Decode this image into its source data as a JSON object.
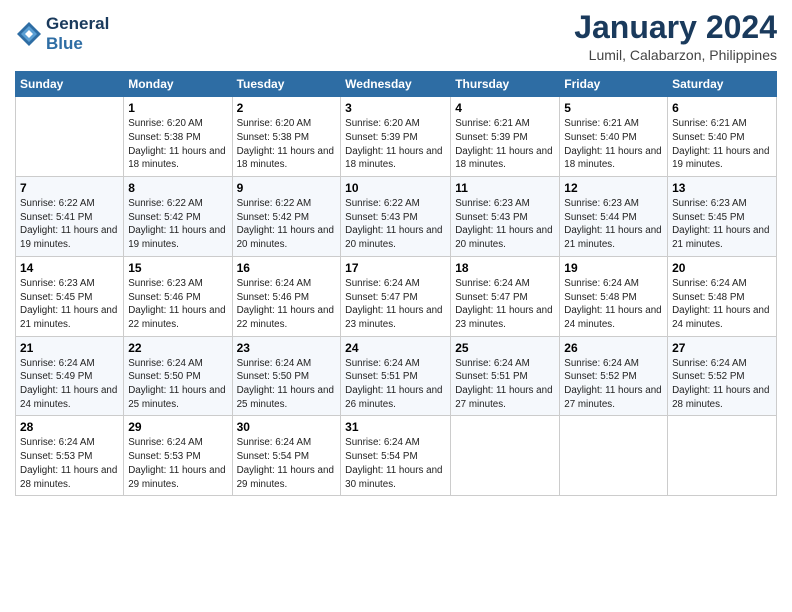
{
  "logo": {
    "text_line1": "General",
    "text_line2": "Blue"
  },
  "header": {
    "month_title": "January 2024",
    "subtitle": "Lumil, Calabarzon, Philippines"
  },
  "days_of_week": [
    "Sunday",
    "Monday",
    "Tuesday",
    "Wednesday",
    "Thursday",
    "Friday",
    "Saturday"
  ],
  "weeks": [
    [
      {
        "day": "",
        "sunrise": "",
        "sunset": "",
        "daylight": ""
      },
      {
        "day": "1",
        "sunrise": "Sunrise: 6:20 AM",
        "sunset": "Sunset: 5:38 PM",
        "daylight": "Daylight: 11 hours and 18 minutes."
      },
      {
        "day": "2",
        "sunrise": "Sunrise: 6:20 AM",
        "sunset": "Sunset: 5:38 PM",
        "daylight": "Daylight: 11 hours and 18 minutes."
      },
      {
        "day": "3",
        "sunrise": "Sunrise: 6:20 AM",
        "sunset": "Sunset: 5:39 PM",
        "daylight": "Daylight: 11 hours and 18 minutes."
      },
      {
        "day": "4",
        "sunrise": "Sunrise: 6:21 AM",
        "sunset": "Sunset: 5:39 PM",
        "daylight": "Daylight: 11 hours and 18 minutes."
      },
      {
        "day": "5",
        "sunrise": "Sunrise: 6:21 AM",
        "sunset": "Sunset: 5:40 PM",
        "daylight": "Daylight: 11 hours and 18 minutes."
      },
      {
        "day": "6",
        "sunrise": "Sunrise: 6:21 AM",
        "sunset": "Sunset: 5:40 PM",
        "daylight": "Daylight: 11 hours and 19 minutes."
      }
    ],
    [
      {
        "day": "7",
        "sunrise": "Sunrise: 6:22 AM",
        "sunset": "Sunset: 5:41 PM",
        "daylight": "Daylight: 11 hours and 19 minutes."
      },
      {
        "day": "8",
        "sunrise": "Sunrise: 6:22 AM",
        "sunset": "Sunset: 5:42 PM",
        "daylight": "Daylight: 11 hours and 19 minutes."
      },
      {
        "day": "9",
        "sunrise": "Sunrise: 6:22 AM",
        "sunset": "Sunset: 5:42 PM",
        "daylight": "Daylight: 11 hours and 20 minutes."
      },
      {
        "day": "10",
        "sunrise": "Sunrise: 6:22 AM",
        "sunset": "Sunset: 5:43 PM",
        "daylight": "Daylight: 11 hours and 20 minutes."
      },
      {
        "day": "11",
        "sunrise": "Sunrise: 6:23 AM",
        "sunset": "Sunset: 5:43 PM",
        "daylight": "Daylight: 11 hours and 20 minutes."
      },
      {
        "day": "12",
        "sunrise": "Sunrise: 6:23 AM",
        "sunset": "Sunset: 5:44 PM",
        "daylight": "Daylight: 11 hours and 21 minutes."
      },
      {
        "day": "13",
        "sunrise": "Sunrise: 6:23 AM",
        "sunset": "Sunset: 5:45 PM",
        "daylight": "Daylight: 11 hours and 21 minutes."
      }
    ],
    [
      {
        "day": "14",
        "sunrise": "Sunrise: 6:23 AM",
        "sunset": "Sunset: 5:45 PM",
        "daylight": "Daylight: 11 hours and 21 minutes."
      },
      {
        "day": "15",
        "sunrise": "Sunrise: 6:23 AM",
        "sunset": "Sunset: 5:46 PM",
        "daylight": "Daylight: 11 hours and 22 minutes."
      },
      {
        "day": "16",
        "sunrise": "Sunrise: 6:24 AM",
        "sunset": "Sunset: 5:46 PM",
        "daylight": "Daylight: 11 hours and 22 minutes."
      },
      {
        "day": "17",
        "sunrise": "Sunrise: 6:24 AM",
        "sunset": "Sunset: 5:47 PM",
        "daylight": "Daylight: 11 hours and 23 minutes."
      },
      {
        "day": "18",
        "sunrise": "Sunrise: 6:24 AM",
        "sunset": "Sunset: 5:47 PM",
        "daylight": "Daylight: 11 hours and 23 minutes."
      },
      {
        "day": "19",
        "sunrise": "Sunrise: 6:24 AM",
        "sunset": "Sunset: 5:48 PM",
        "daylight": "Daylight: 11 hours and 24 minutes."
      },
      {
        "day": "20",
        "sunrise": "Sunrise: 6:24 AM",
        "sunset": "Sunset: 5:48 PM",
        "daylight": "Daylight: 11 hours and 24 minutes."
      }
    ],
    [
      {
        "day": "21",
        "sunrise": "Sunrise: 6:24 AM",
        "sunset": "Sunset: 5:49 PM",
        "daylight": "Daylight: 11 hours and 24 minutes."
      },
      {
        "day": "22",
        "sunrise": "Sunrise: 6:24 AM",
        "sunset": "Sunset: 5:50 PM",
        "daylight": "Daylight: 11 hours and 25 minutes."
      },
      {
        "day": "23",
        "sunrise": "Sunrise: 6:24 AM",
        "sunset": "Sunset: 5:50 PM",
        "daylight": "Daylight: 11 hours and 25 minutes."
      },
      {
        "day": "24",
        "sunrise": "Sunrise: 6:24 AM",
        "sunset": "Sunset: 5:51 PM",
        "daylight": "Daylight: 11 hours and 26 minutes."
      },
      {
        "day": "25",
        "sunrise": "Sunrise: 6:24 AM",
        "sunset": "Sunset: 5:51 PM",
        "daylight": "Daylight: 11 hours and 27 minutes."
      },
      {
        "day": "26",
        "sunrise": "Sunrise: 6:24 AM",
        "sunset": "Sunset: 5:52 PM",
        "daylight": "Daylight: 11 hours and 27 minutes."
      },
      {
        "day": "27",
        "sunrise": "Sunrise: 6:24 AM",
        "sunset": "Sunset: 5:52 PM",
        "daylight": "Daylight: 11 hours and 28 minutes."
      }
    ],
    [
      {
        "day": "28",
        "sunrise": "Sunrise: 6:24 AM",
        "sunset": "Sunset: 5:53 PM",
        "daylight": "Daylight: 11 hours and 28 minutes."
      },
      {
        "day": "29",
        "sunrise": "Sunrise: 6:24 AM",
        "sunset": "Sunset: 5:53 PM",
        "daylight": "Daylight: 11 hours and 29 minutes."
      },
      {
        "day": "30",
        "sunrise": "Sunrise: 6:24 AM",
        "sunset": "Sunset: 5:54 PM",
        "daylight": "Daylight: 11 hours and 29 minutes."
      },
      {
        "day": "31",
        "sunrise": "Sunrise: 6:24 AM",
        "sunset": "Sunset: 5:54 PM",
        "daylight": "Daylight: 11 hours and 30 minutes."
      },
      {
        "day": "",
        "sunrise": "",
        "sunset": "",
        "daylight": ""
      },
      {
        "day": "",
        "sunrise": "",
        "sunset": "",
        "daylight": ""
      },
      {
        "day": "",
        "sunrise": "",
        "sunset": "",
        "daylight": ""
      }
    ]
  ]
}
